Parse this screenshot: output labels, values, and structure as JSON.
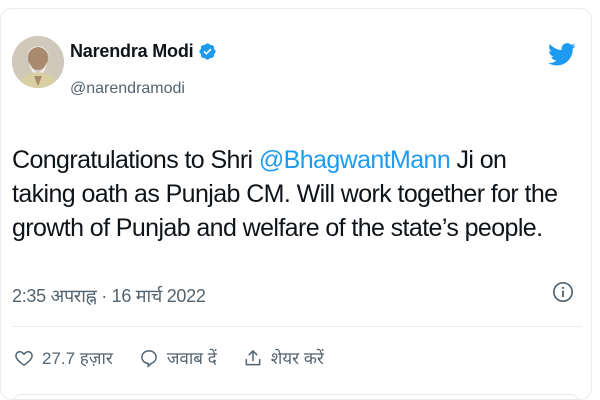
{
  "author": {
    "display_name": "Narendra Modi",
    "handle": "@narendramodi",
    "avatar_icon": "profile-photo-avatar",
    "verified_icon": "verified-badge-icon"
  },
  "brand": {
    "icon": "twitter-bird-icon",
    "color": "#1d9bf0"
  },
  "tweet": {
    "text_before": "Congratulations to Shri ",
    "mention": "@BhagwantMann",
    "text_after": " Ji on taking oath as Punjab CM. Will work together for the growth of Punjab and welfare of the state’s people."
  },
  "meta": {
    "timestamp": "2:35 अपराह्न · 16 मार्च 2022",
    "info_icon": "info-icon"
  },
  "actions": {
    "like_count": "27.7 हज़ार",
    "reply_label": "जवाब दें",
    "share_label": "शेयर करें"
  },
  "colors": {
    "text": "#0f1419",
    "secondary": "#536471",
    "accent": "#1d9bf0",
    "border": "#e6ecf0"
  }
}
